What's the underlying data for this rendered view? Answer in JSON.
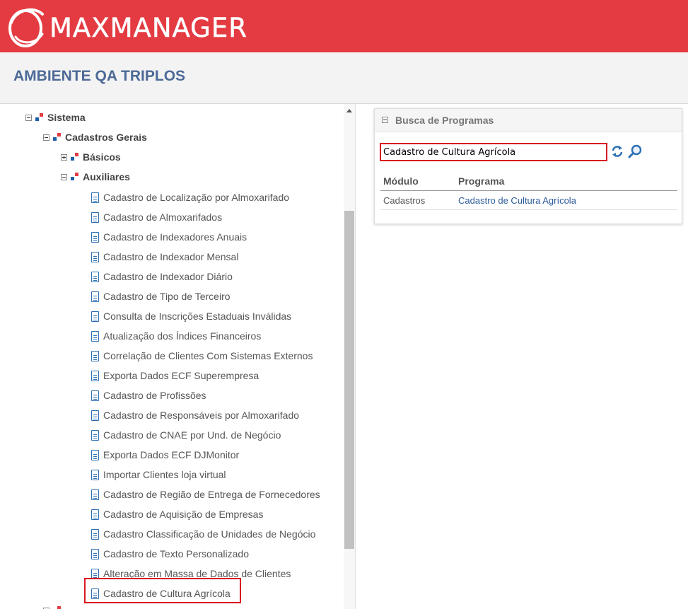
{
  "header": {
    "brand": "MAXMANAGER",
    "brand_color": "#e43b42"
  },
  "environment": {
    "title": "AMBIENTE QA TRIPLOS"
  },
  "tree": {
    "root": "Sistema",
    "cadastros_gerais": "Cadastros Gerais",
    "basicos": "Básicos",
    "auxiliares": "Auxiliares",
    "items": [
      "Cadastro de Localização por Almoxarifado",
      "Cadastro de Almoxarifados",
      "Cadastro de Indexadores Anuais",
      "Cadastro de Indexador Mensal",
      "Cadastro de Indexador Diário",
      "Cadastro de Tipo de Terceiro",
      "Consulta de Inscrições Estaduais Inválidas",
      "Atualização dos Índices Financeiros",
      "Correlação de Clientes Com Sistemas Externos",
      "Exporta Dados ECF Superempresa",
      "Cadastro de Profissões",
      "Cadastro de Responsáveis por Almoxarifado",
      "Cadastro de CNAE por Und. de Negócio",
      "Exporta Dados ECF DJMonitor",
      "Importar Clientes loja virtual",
      "Cadastro de Região de Entrega de Fornecedores",
      "Cadastro de Aquisição de Empresas",
      "Cadastro Classificação de Unidades de Negócio",
      "Cadastro de Texto Personalizado",
      "Alteração em Massa de Dados de Clientes",
      "Cadastro de Cultura Agrícola"
    ]
  },
  "search_panel": {
    "title": "Busca de Programas",
    "search_value": "Cadastro de Cultura Agrícola",
    "columns": [
      "Módulo",
      "Programa"
    ],
    "rows": [
      {
        "module": "Cadastros",
        "program": "Cadastro de Cultura Agrícola"
      }
    ]
  }
}
